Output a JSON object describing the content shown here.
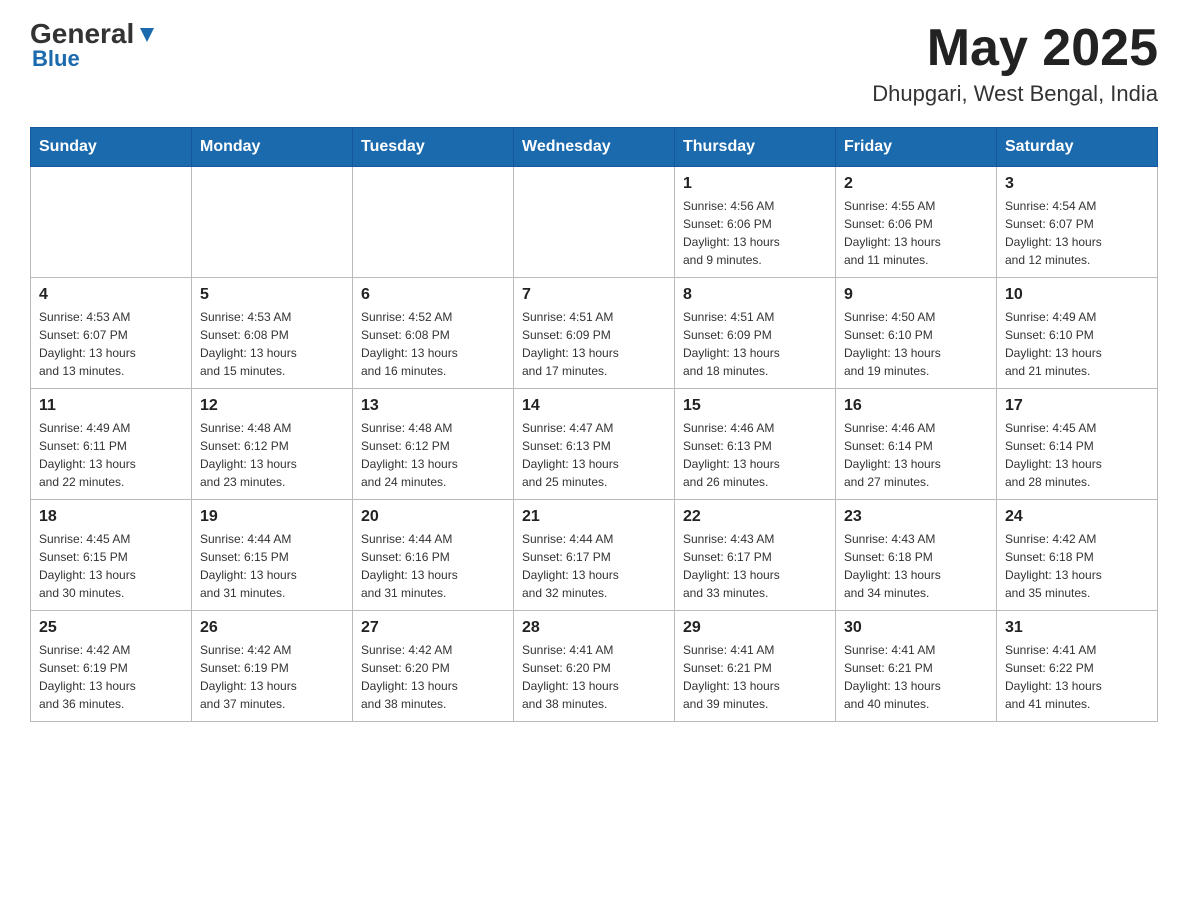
{
  "header": {
    "logo_text_general": "General",
    "logo_text_blue": "Blue",
    "main_title": "May 2025",
    "subtitle": "Dhupgari, West Bengal, India"
  },
  "weekdays": [
    "Sunday",
    "Monday",
    "Tuesday",
    "Wednesday",
    "Thursday",
    "Friday",
    "Saturday"
  ],
  "weeks": [
    [
      {
        "day": "",
        "info": ""
      },
      {
        "day": "",
        "info": ""
      },
      {
        "day": "",
        "info": ""
      },
      {
        "day": "",
        "info": ""
      },
      {
        "day": "1",
        "info": "Sunrise: 4:56 AM\nSunset: 6:06 PM\nDaylight: 13 hours\nand 9 minutes."
      },
      {
        "day": "2",
        "info": "Sunrise: 4:55 AM\nSunset: 6:06 PM\nDaylight: 13 hours\nand 11 minutes."
      },
      {
        "day": "3",
        "info": "Sunrise: 4:54 AM\nSunset: 6:07 PM\nDaylight: 13 hours\nand 12 minutes."
      }
    ],
    [
      {
        "day": "4",
        "info": "Sunrise: 4:53 AM\nSunset: 6:07 PM\nDaylight: 13 hours\nand 13 minutes."
      },
      {
        "day": "5",
        "info": "Sunrise: 4:53 AM\nSunset: 6:08 PM\nDaylight: 13 hours\nand 15 minutes."
      },
      {
        "day": "6",
        "info": "Sunrise: 4:52 AM\nSunset: 6:08 PM\nDaylight: 13 hours\nand 16 minutes."
      },
      {
        "day": "7",
        "info": "Sunrise: 4:51 AM\nSunset: 6:09 PM\nDaylight: 13 hours\nand 17 minutes."
      },
      {
        "day": "8",
        "info": "Sunrise: 4:51 AM\nSunset: 6:09 PM\nDaylight: 13 hours\nand 18 minutes."
      },
      {
        "day": "9",
        "info": "Sunrise: 4:50 AM\nSunset: 6:10 PM\nDaylight: 13 hours\nand 19 minutes."
      },
      {
        "day": "10",
        "info": "Sunrise: 4:49 AM\nSunset: 6:10 PM\nDaylight: 13 hours\nand 21 minutes."
      }
    ],
    [
      {
        "day": "11",
        "info": "Sunrise: 4:49 AM\nSunset: 6:11 PM\nDaylight: 13 hours\nand 22 minutes."
      },
      {
        "day": "12",
        "info": "Sunrise: 4:48 AM\nSunset: 6:12 PM\nDaylight: 13 hours\nand 23 minutes."
      },
      {
        "day": "13",
        "info": "Sunrise: 4:48 AM\nSunset: 6:12 PM\nDaylight: 13 hours\nand 24 minutes."
      },
      {
        "day": "14",
        "info": "Sunrise: 4:47 AM\nSunset: 6:13 PM\nDaylight: 13 hours\nand 25 minutes."
      },
      {
        "day": "15",
        "info": "Sunrise: 4:46 AM\nSunset: 6:13 PM\nDaylight: 13 hours\nand 26 minutes."
      },
      {
        "day": "16",
        "info": "Sunrise: 4:46 AM\nSunset: 6:14 PM\nDaylight: 13 hours\nand 27 minutes."
      },
      {
        "day": "17",
        "info": "Sunrise: 4:45 AM\nSunset: 6:14 PM\nDaylight: 13 hours\nand 28 minutes."
      }
    ],
    [
      {
        "day": "18",
        "info": "Sunrise: 4:45 AM\nSunset: 6:15 PM\nDaylight: 13 hours\nand 30 minutes."
      },
      {
        "day": "19",
        "info": "Sunrise: 4:44 AM\nSunset: 6:15 PM\nDaylight: 13 hours\nand 31 minutes."
      },
      {
        "day": "20",
        "info": "Sunrise: 4:44 AM\nSunset: 6:16 PM\nDaylight: 13 hours\nand 31 minutes."
      },
      {
        "day": "21",
        "info": "Sunrise: 4:44 AM\nSunset: 6:17 PM\nDaylight: 13 hours\nand 32 minutes."
      },
      {
        "day": "22",
        "info": "Sunrise: 4:43 AM\nSunset: 6:17 PM\nDaylight: 13 hours\nand 33 minutes."
      },
      {
        "day": "23",
        "info": "Sunrise: 4:43 AM\nSunset: 6:18 PM\nDaylight: 13 hours\nand 34 minutes."
      },
      {
        "day": "24",
        "info": "Sunrise: 4:42 AM\nSunset: 6:18 PM\nDaylight: 13 hours\nand 35 minutes."
      }
    ],
    [
      {
        "day": "25",
        "info": "Sunrise: 4:42 AM\nSunset: 6:19 PM\nDaylight: 13 hours\nand 36 minutes."
      },
      {
        "day": "26",
        "info": "Sunrise: 4:42 AM\nSunset: 6:19 PM\nDaylight: 13 hours\nand 37 minutes."
      },
      {
        "day": "27",
        "info": "Sunrise: 4:42 AM\nSunset: 6:20 PM\nDaylight: 13 hours\nand 38 minutes."
      },
      {
        "day": "28",
        "info": "Sunrise: 4:41 AM\nSunset: 6:20 PM\nDaylight: 13 hours\nand 38 minutes."
      },
      {
        "day": "29",
        "info": "Sunrise: 4:41 AM\nSunset: 6:21 PM\nDaylight: 13 hours\nand 39 minutes."
      },
      {
        "day": "30",
        "info": "Sunrise: 4:41 AM\nSunset: 6:21 PM\nDaylight: 13 hours\nand 40 minutes."
      },
      {
        "day": "31",
        "info": "Sunrise: 4:41 AM\nSunset: 6:22 PM\nDaylight: 13 hours\nand 41 minutes."
      }
    ]
  ]
}
